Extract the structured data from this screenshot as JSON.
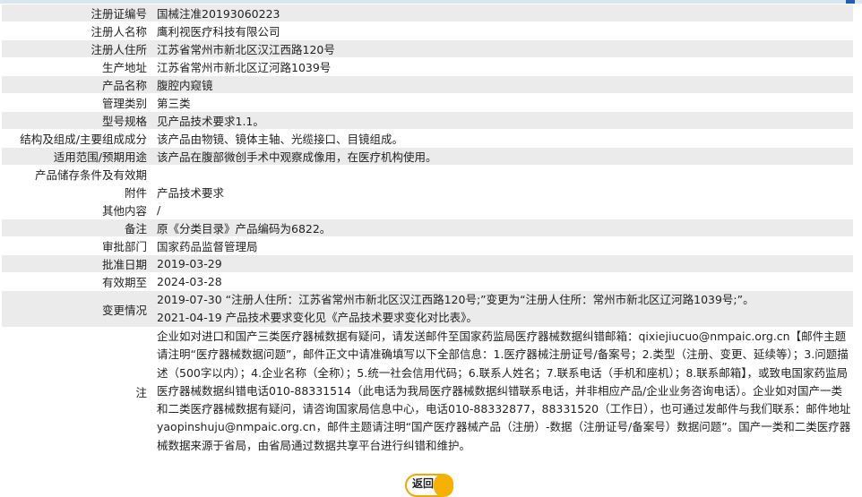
{
  "rows": [
    {
      "label": "注册证编号",
      "value": "国械注准20193060223"
    },
    {
      "label": "注册人名称",
      "value": "鹰利视医疗科技有限公司"
    },
    {
      "label": "注册人住所",
      "value": "江苏省常州市新北区汉江西路120号"
    },
    {
      "label": "生产地址",
      "value": "江苏省常州市新北区辽河路1039号"
    },
    {
      "label": "产品名称",
      "value": "腹腔内窥镜"
    },
    {
      "label": "管理类别",
      "value": "第三类"
    },
    {
      "label": "型号规格",
      "value": "见产品技术要求1.1。"
    },
    {
      "label": "结构及组成/主要组成成分",
      "value": "该产品由物镜、镜体主轴、光缆接口、目镜组成。"
    },
    {
      "label": "适用范围/预期用途",
      "value": "该产品在腹部微创手术中观察成像用，在医疗机构使用。"
    },
    {
      "label": "产品储存条件及有效期",
      "value": ""
    },
    {
      "label": "附件",
      "value": "产品技术要求"
    },
    {
      "label": "其他内容",
      "value": "/"
    },
    {
      "label": "备注",
      "value": "原《分类目录》产品编码为6822。"
    },
    {
      "label": "审批部门",
      "value": "国家药品监督管理局"
    },
    {
      "label": "批准日期",
      "value": "2019-03-29"
    },
    {
      "label": "有效期至",
      "value": "2024-03-28"
    }
  ],
  "changes": {
    "label": "变更情况",
    "lines": [
      "2019-07-30 “注册人住所：江苏省常州市新北区汉江西路120号;”变更为“注册人住所：常州市新北区辽河路1039号;”。",
      "2021-04-19 产品技术要求变化见《产品技术要求变化对比表》。"
    ]
  },
  "note": {
    "label": "注",
    "text": "企业如对进口和国产三类医疗器械数据有疑问，请发送邮件至国家药监局医疗器械数据纠错邮箱：qixiejiucuo@nmpaic.org.cn【邮件主题请注明“医疗器械数据问题”，邮件正文中请准确填写以下全部信息：1.医疗器械注册证号/备案号；2.类型（注册、变更、延续等）；3.问题描述（500字以内）；4.企业名称（全称）；5.统一社会信用代码；6.联系人姓名；7.联系电话（手机和座机）；8.联系邮箱】，或致电国家药监局医疗器械数据纠错电话010-88331514（此电话为我局医疗器械数据纠错联系电话，并非相应产品/企业业务咨询电话）。企业如对国产一类和二类医疗器械数据有疑问，请咨询国家局信息中心，电话010-88332877，88331520（工作日），也可通过发邮件与我们联系：邮件地址yaopinshuju@nmpaic.org.cn，邮件主题请注明“国产医疗器械产品（注册）-数据（注册证号/备案号）数据问题”。国产一类和二类医疗器械数据来源于省局，由省局通过数据共享平台进行纠错和维护。"
  },
  "back_button": {
    "label": "返回"
  }
}
